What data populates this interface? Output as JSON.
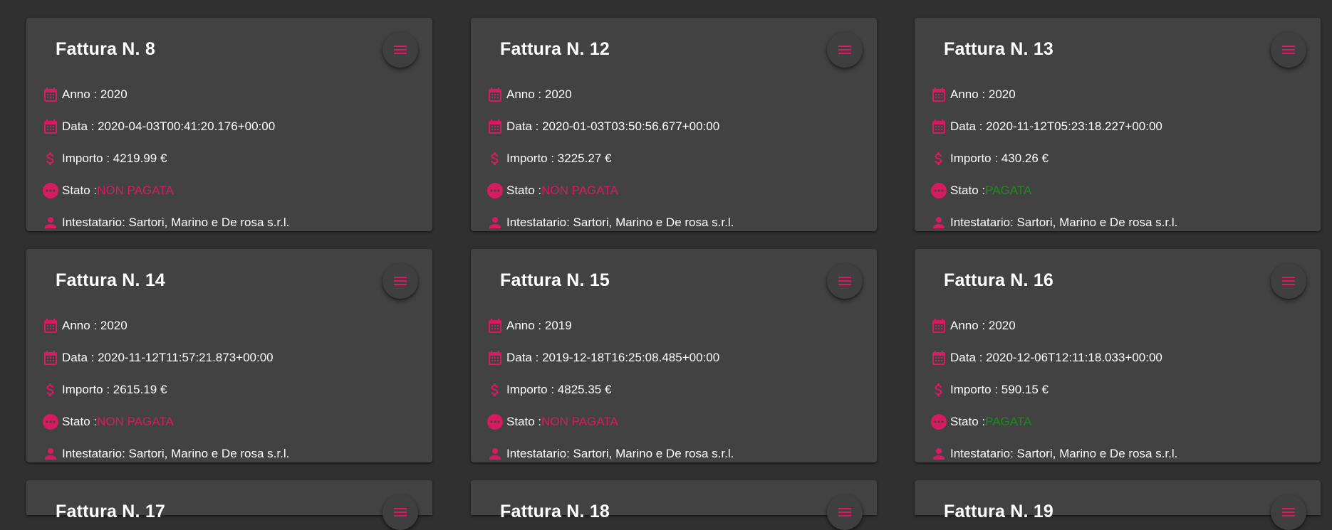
{
  "colors": {
    "background": "#303030",
    "card": "#424242",
    "accent": "#d81b60",
    "paid": "#1e8b1e",
    "text": "#ffffff"
  },
  "icons": {
    "menu": "menu-icon",
    "year": "calendar-icon",
    "date": "calendar-icon",
    "amount": "dollar-icon",
    "status": "more-horiz-circle-icon",
    "holder": "person-icon"
  },
  "invoices": [
    {
      "title": "Fattura N. 8",
      "year": "Anno : 2020",
      "date": "Data : 2020-04-03T00:41:20.176+00:00",
      "amount": "Importo : 4219.99 €",
      "status_label": "Stato :",
      "status_value": "NON PAGATA",
      "status_paid": false,
      "holder": "Intestatario: Sartori, Marino e De rosa s.r.l."
    },
    {
      "title": "Fattura N. 12",
      "year": "Anno : 2020",
      "date": "Data : 2020-01-03T03:50:56.677+00:00",
      "amount": "Importo : 3225.27 €",
      "status_label": "Stato :",
      "status_value": "NON PAGATA",
      "status_paid": false,
      "holder": "Intestatario: Sartori, Marino e De rosa s.r.l."
    },
    {
      "title": "Fattura N. 13",
      "year": "Anno : 2020",
      "date": "Data : 2020-11-12T05:23:18.227+00:00",
      "amount": "Importo : 430.26 €",
      "status_label": "Stato :",
      "status_value": "PAGATA",
      "status_paid": true,
      "holder": "Intestatario: Sartori, Marino e De rosa s.r.l."
    },
    {
      "title": "Fattura N. 14",
      "year": "Anno : 2020",
      "date": "Data : 2020-11-12T11:57:21.873+00:00",
      "amount": "Importo : 2615.19 €",
      "status_label": "Stato :",
      "status_value": "NON PAGATA",
      "status_paid": false,
      "holder": "Intestatario: Sartori, Marino e De rosa s.r.l."
    },
    {
      "title": "Fattura N. 15",
      "year": "Anno : 2019",
      "date": "Data : 2019-12-18T16:25:08.485+00:00",
      "amount": "Importo : 4825.35 €",
      "status_label": "Stato :",
      "status_value": "NON PAGATA",
      "status_paid": false,
      "holder": "Intestatario: Sartori, Marino e De rosa s.r.l."
    },
    {
      "title": "Fattura N. 16",
      "year": "Anno : 2020",
      "date": "Data : 2020-12-06T12:11:18.033+00:00",
      "amount": "Importo : 590.15 €",
      "status_label": "Stato :",
      "status_value": "PAGATA",
      "status_paid": true,
      "holder": "Intestatario: Sartori, Marino e De rosa s.r.l."
    },
    {
      "title": "Fattura N. 17"
    },
    {
      "title": "Fattura N. 18"
    },
    {
      "title": "Fattura N. 19"
    }
  ]
}
